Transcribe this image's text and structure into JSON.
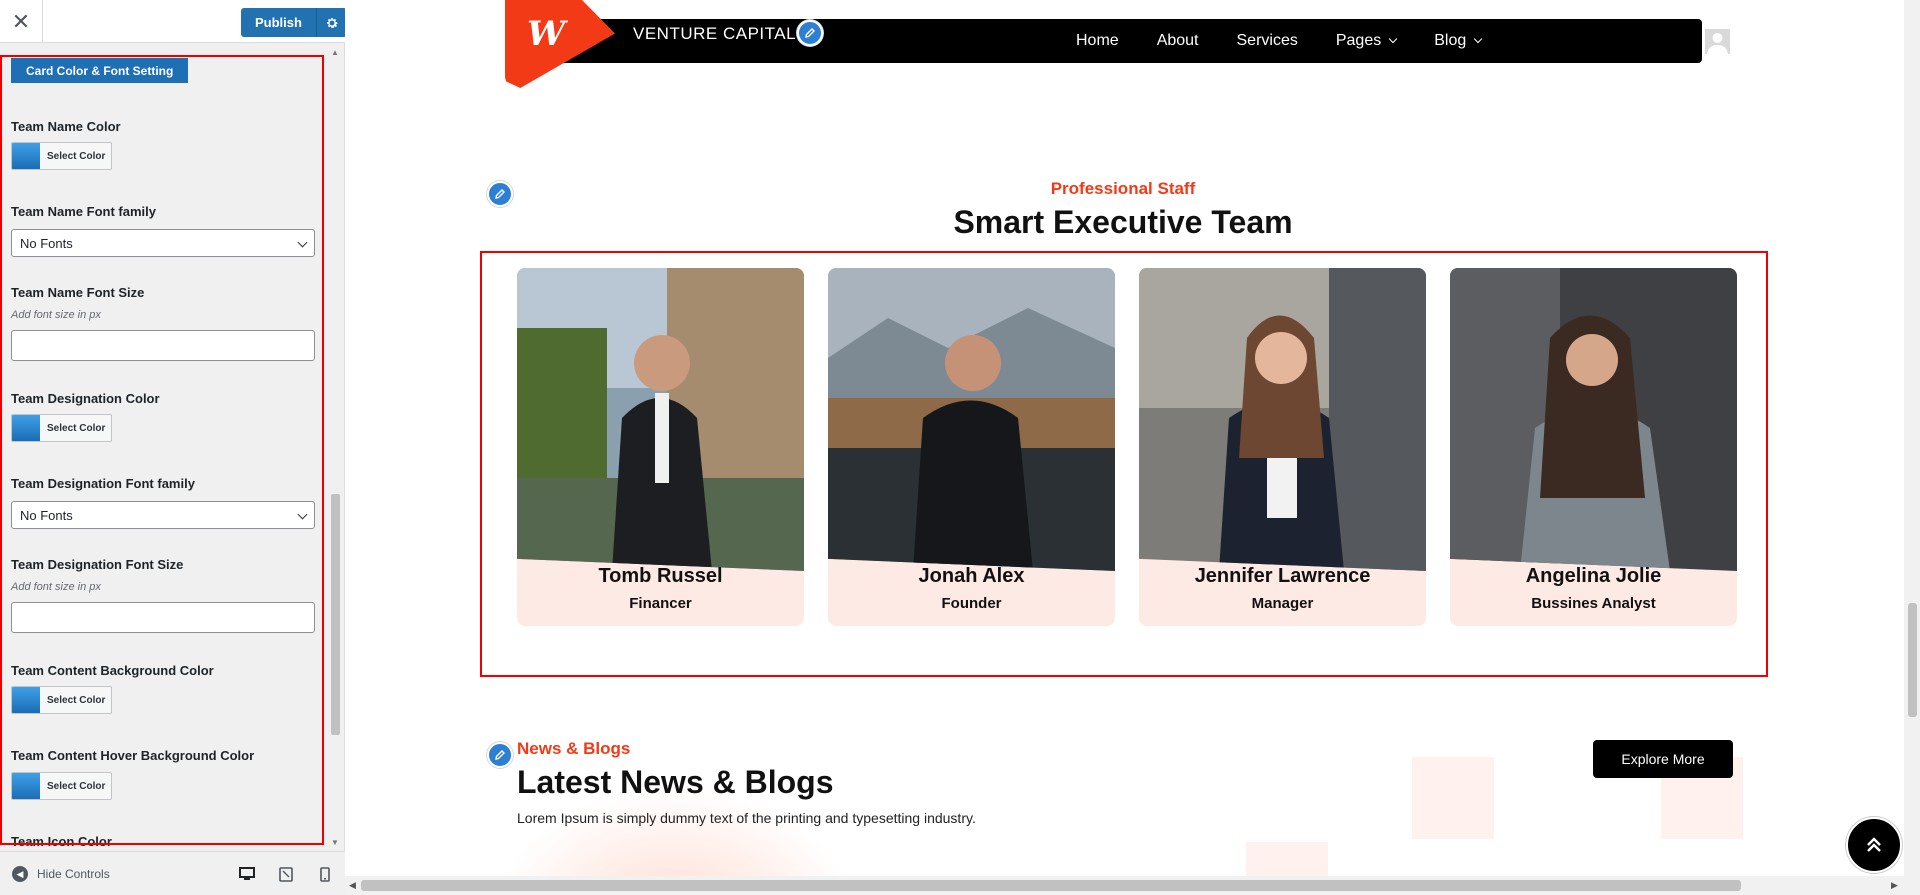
{
  "sidebar": {
    "publish_label": "Publish",
    "section_title": "Card Color & Font Setting",
    "select_color_label": "Select Color",
    "fields": {
      "name_color": "Team Name Color",
      "name_font_family": "Team Name Font family",
      "name_font_family_value": "No Fonts",
      "name_font_size": "Team Name Font Size",
      "font_size_hint": "Add font size in px",
      "designation_color": "Team Designation Color",
      "designation_font_family": "Team Designation Font family",
      "designation_font_family_value": "No Fonts",
      "designation_font_size": "Team Designation Font Size",
      "content_bg_color": "Team Content Background Color",
      "content_hover_bg_color": "Team Content Hover Background Color",
      "icon_color": "Team Icon Color"
    },
    "hide_controls": "Hide Controls",
    "accent_color": "#2271b1"
  },
  "site": {
    "brand": "VENTURE CAPITAL",
    "brand_color": "#f23a16",
    "nav": [
      "Home",
      "About",
      "Services",
      "Pages",
      "Blog"
    ],
    "team": {
      "eyebrow": "Professional Staff",
      "title": "Smart Executive Team",
      "members": [
        {
          "name": "Tomb Russel",
          "role": "Financer"
        },
        {
          "name": "Jonah Alex",
          "role": "Founder"
        },
        {
          "name": "Jennifer Lawrence",
          "role": "Manager"
        },
        {
          "name": "Angelina Jolie",
          "role": "Bussines Analyst"
        }
      ]
    },
    "news": {
      "eyebrow": "News & Blogs",
      "title": "Latest News & Blogs",
      "description": "Lorem Ipsum is simply dummy text of the printing and typesetting industry.",
      "button": "Explore More"
    }
  }
}
